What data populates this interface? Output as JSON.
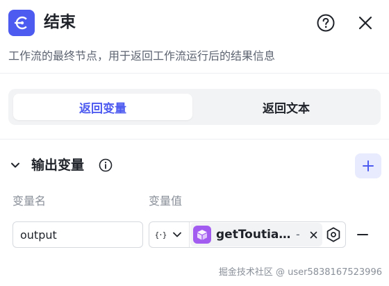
{
  "header": {
    "title": "结束",
    "description": "工作流的最终节点，用于返回工作流运行后的结果信息",
    "node_icon": "end-node-icon",
    "help_icon": "question-circle-icon",
    "close_icon": "close-icon"
  },
  "tabs": [
    {
      "label": "返回变量",
      "active": true
    },
    {
      "label": "返回文本",
      "active": false
    }
  ],
  "output_section": {
    "title": "输出变量",
    "columns": {
      "name": "变量名",
      "value": "变量值"
    },
    "rows": [
      {
        "name": "output",
        "type_symbol": "{⋅}",
        "reference": "getToutiao...",
        "reference_suffix": "-"
      }
    ]
  },
  "watermark": "掘金技术社区 @ user5838167523996",
  "colors": {
    "accent": "#4e5bf0",
    "plugin": "#a25cf0",
    "add_button_bg": "#e8eafd"
  }
}
